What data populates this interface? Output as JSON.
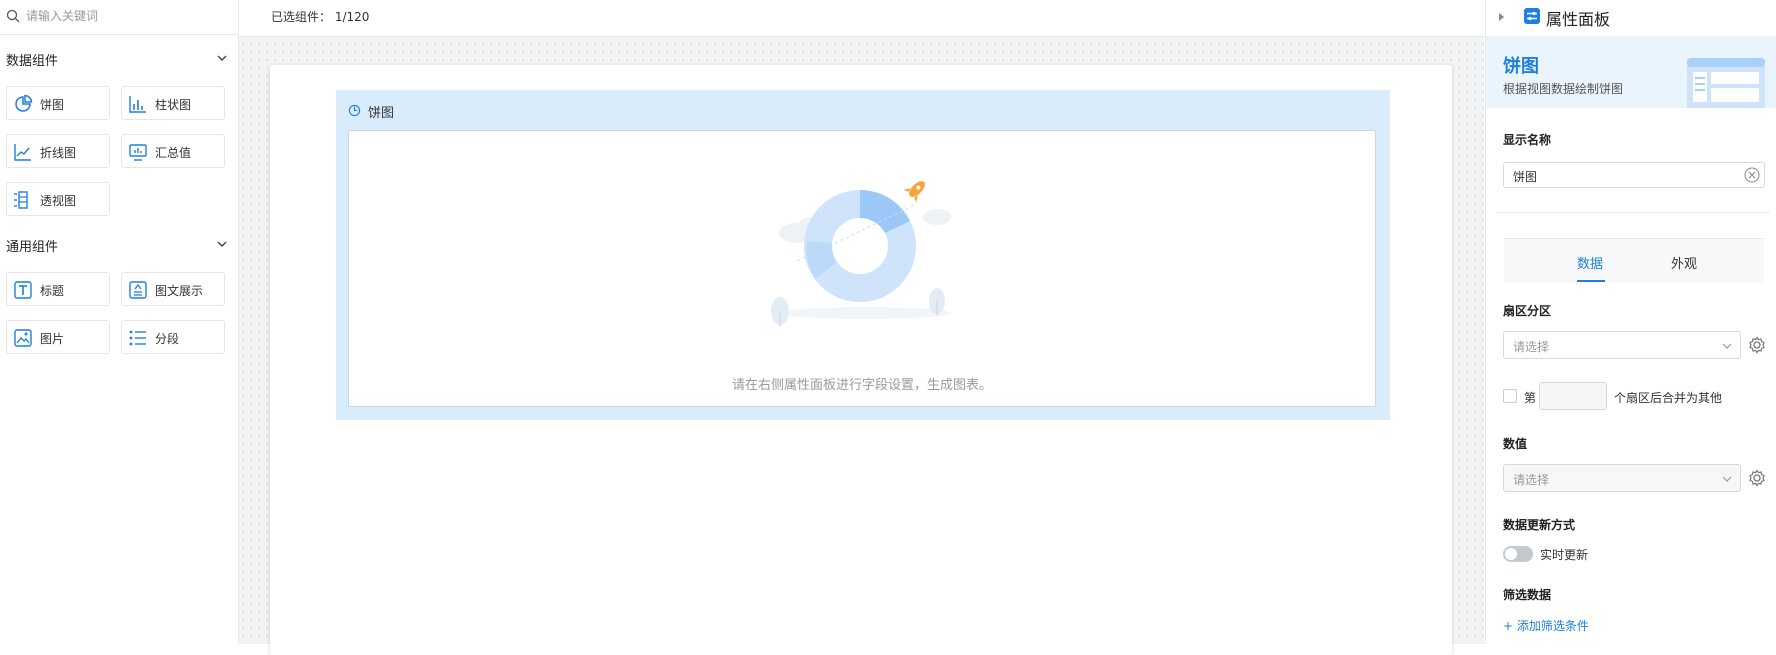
{
  "search": {
    "placeholder": "请输入关键词"
  },
  "groups": [
    {
      "title": "数据组件",
      "items": [
        {
          "label": "饼图",
          "icon": "pie-chart-icon"
        },
        {
          "label": "柱状图",
          "icon": "bar-chart-icon"
        },
        {
          "label": "折线图",
          "icon": "line-chart-icon"
        },
        {
          "label": "汇总值",
          "icon": "summary-value-icon"
        },
        {
          "label": "透视图",
          "icon": "pivot-table-icon"
        }
      ]
    },
    {
      "title": "通用组件",
      "items": [
        {
          "label": "标题",
          "icon": "title-text-icon"
        },
        {
          "label": "图文展示",
          "icon": "image-text-icon"
        },
        {
          "label": "图片",
          "icon": "image-icon"
        },
        {
          "label": "分段",
          "icon": "list-section-icon"
        }
      ]
    }
  ],
  "topbar": {
    "selected_label": "已选组件：",
    "selected_count": "1/120"
  },
  "widget": {
    "title": "饼图",
    "empty_hint": "请在右侧属性面板进行字段设置，生成图表。"
  },
  "panel": {
    "title": "属性面板",
    "banner_title": "饼图",
    "banner_subtitle": "根据视图数据绘制饼图",
    "display_name_label": "显示名称",
    "display_name_value": "饼图",
    "tabs": [
      "数据",
      "外观"
    ],
    "active_tab": "数据",
    "sector_label": "扇区分区",
    "select_placeholder": "请选择",
    "merge_prefix": "第",
    "merge_suffix": "个扇区后合并为其他",
    "value_label": "数值",
    "update_label": "数据更新方式",
    "update_toggle": "实时更新",
    "filter_label": "筛选数据",
    "add_filter": "+ 添加筛选条件"
  },
  "colors": {
    "accent": "#1e7fe0",
    "widget_bg": "#d9ecfc",
    "panel_banner": "#eaf4fd"
  }
}
